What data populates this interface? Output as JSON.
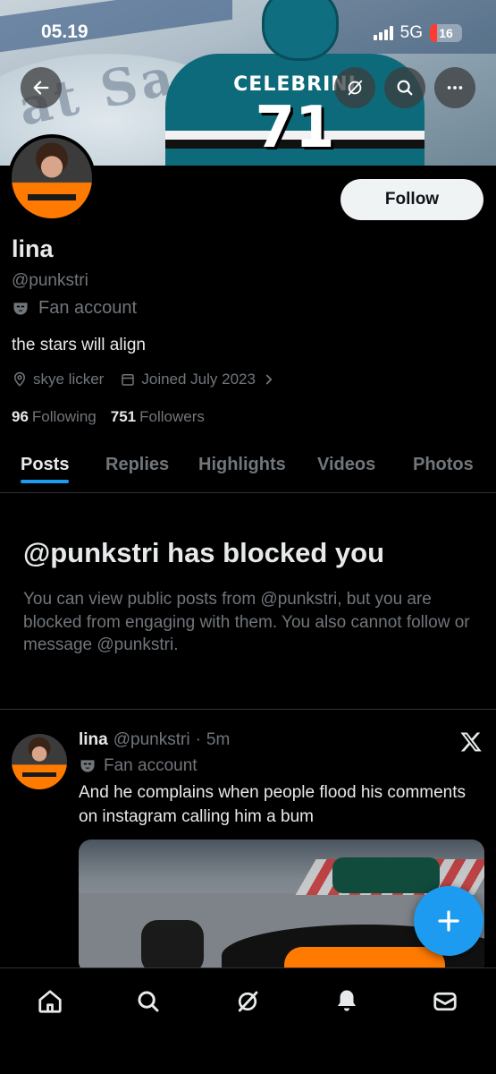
{
  "status_bar": {
    "time": "05.19",
    "network": "5G",
    "battery": "16"
  },
  "profile": {
    "name": "lina",
    "handle": "@punkstri",
    "label": "Fan account",
    "bio": "the stars will align",
    "location": "skye licker",
    "joined": "Joined July 2023",
    "following_count": "96",
    "following_label": "Following",
    "followers_count": "751",
    "followers_label": "Followers",
    "follow_button": "Follow"
  },
  "banner": {
    "jersey_name": "CELEBRINI",
    "jersey_number": "71",
    "ghost_text": "at Sa"
  },
  "tabs": [
    {
      "label": "Posts"
    },
    {
      "label": "Replies"
    },
    {
      "label": "Highlights"
    },
    {
      "label": "Videos"
    },
    {
      "label": "Photos"
    }
  ],
  "blocked": {
    "title": "@punkstri has blocked you",
    "message": "You can view public posts from @punkstri, but you are blocked from engaging with them. You also cannot follow or message @punkstri."
  },
  "post": {
    "name": "lina",
    "handle": "@punkstri",
    "dot": "·",
    "time": "5m",
    "label": "Fan account",
    "text": "And he complains when people flood his comments on instagram calling him a bum"
  },
  "colors": {
    "accent": "#1d9bf0",
    "background": "#000000",
    "muted": "#71767b",
    "text": "#e7e9ea"
  },
  "icons": [
    "back-arrow-icon",
    "grok-icon",
    "search-icon",
    "more-icon",
    "fan-mask-icon",
    "location-icon",
    "calendar-icon",
    "chevron-right-icon",
    "x-logo-icon",
    "plus-icon",
    "home-icon",
    "notifications-icon",
    "messages-icon"
  ]
}
